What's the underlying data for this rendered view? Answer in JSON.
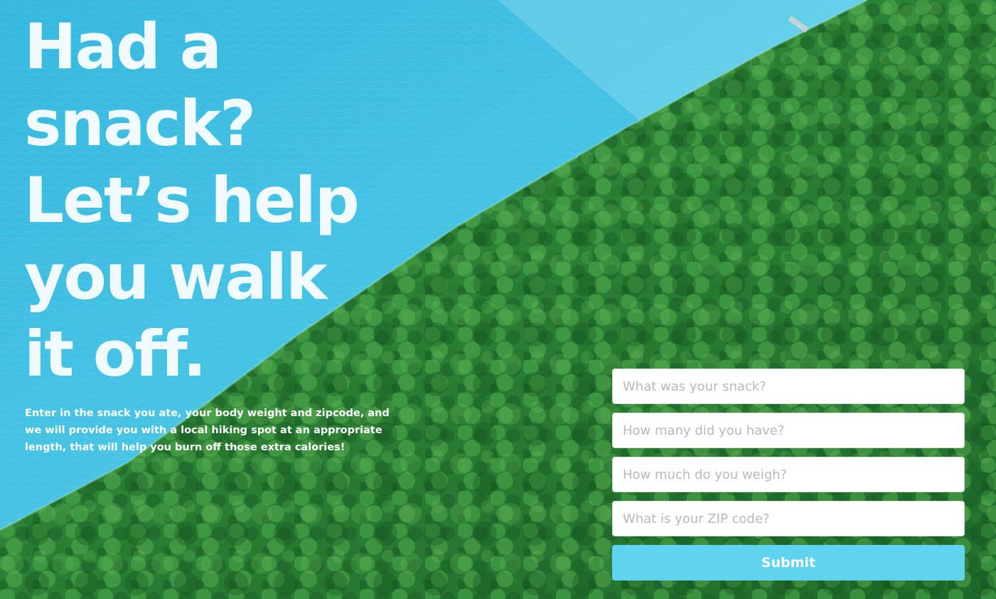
{
  "hero": {
    "lines": [
      "Had a",
      "snack?",
      "Let’s help",
      "you walk",
      "it off."
    ]
  },
  "description": "Enter in the snack you ate, your body weight and zipcode, and we will provide you with a local hiking spot at an appropriate length, that will help you burn off those extra calories!",
  "form": {
    "snack_placeholder": "What was your snack?",
    "quantity_placeholder": "How many did you have?",
    "weight_placeholder": "How much do you weigh?",
    "zip_placeholder": "What is your ZIP code?",
    "submit_label": "Submit"
  },
  "colors": {
    "water": "#4cc3e3",
    "forest": "#2f8a3c",
    "headline": "#f0fbff",
    "submit": "#5fd4f1"
  }
}
